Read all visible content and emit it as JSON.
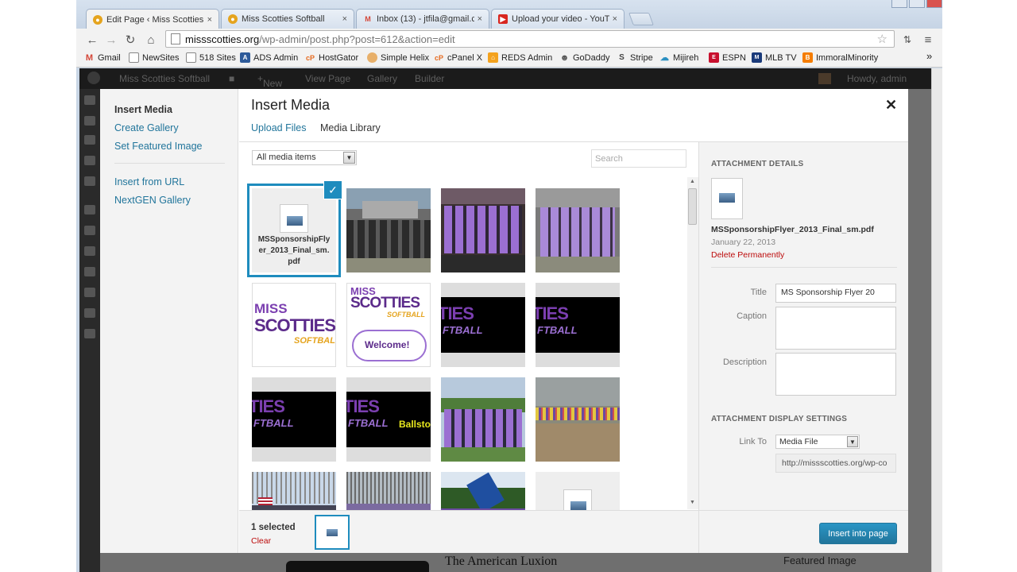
{
  "browser": {
    "tabs": [
      {
        "title": "Edit Page ‹ Miss Scotties S",
        "active": true
      },
      {
        "title": "Miss Scotties Softball",
        "active": false
      },
      {
        "title": "Inbox (13) - jtfila@gmail.c",
        "active": false
      },
      {
        "title": "Upload your video - YouT",
        "active": false
      }
    ],
    "url_domain": "missscotties.org",
    "url_path": "/wp-admin/post.php?post=612&action=edit",
    "bookmarks": [
      "Gmail",
      "NewSites",
      "518 Sites",
      "ADS Admin",
      "HostGator",
      "Simple Helix",
      "cPanel X",
      "REDS Admin",
      "GoDaddy",
      "Stripe",
      "Mijireh",
      "ESPN",
      "MLB TV",
      "ImmoralMinority"
    ]
  },
  "wp_admin_bar": {
    "site": "Miss Scotties Softball",
    "new": "New",
    "view_page": "View Page",
    "gallery": "Gallery",
    "builder": "Builder",
    "howdy": "Howdy, admin"
  },
  "wp_bottom": {
    "featured_image": "Featured Image",
    "page_text": "The American Luxion"
  },
  "media_menu": {
    "items": [
      "Insert Media",
      "Create Gallery",
      "Set Featured Image",
      "Insert from URL",
      "NextGEN Gallery"
    ]
  },
  "frame": {
    "title": "Insert Media",
    "tab_upload": "Upload Files",
    "tab_library": "Media Library",
    "filter": "All media items",
    "search_placeholder": "Search"
  },
  "attachments": [
    {
      "type": "pdf",
      "filename": "MSSponsorshipFlyer_2013_Final_sm.pdf",
      "selected": true
    },
    {
      "type": "photo",
      "desc": "team-photo"
    },
    {
      "type": "photo",
      "desc": "team-photo"
    },
    {
      "type": "photo",
      "desc": "team-photo"
    },
    {
      "type": "logo",
      "text": "MISS SCOTTIES SOFTBALL"
    },
    {
      "type": "logo",
      "text": "Welcome!"
    },
    {
      "type": "banner"
    },
    {
      "type": "banner"
    },
    {
      "type": "banner"
    },
    {
      "type": "banner",
      "text": "Ballsto"
    },
    {
      "type": "photo",
      "desc": "team-photo"
    },
    {
      "type": "photo",
      "desc": "field-photo"
    },
    {
      "type": "photo",
      "desc": "parade-photo"
    },
    {
      "type": "photo",
      "desc": "parade-photo"
    },
    {
      "type": "photo",
      "desc": "parade-photo"
    },
    {
      "type": "pdf"
    }
  ],
  "details": {
    "heading": "Attachment Details",
    "filename": "MSSponsorshipFlyer_2013_Final_sm.pdf",
    "date": "January 22, 2013",
    "delete": "Delete Permanently",
    "title_label": "Title",
    "title_value": "MS Sponsorship Flyer 20",
    "caption_label": "Caption",
    "description_label": "Description",
    "display_heading": "Attachment Display Settings",
    "link_to_label": "Link To",
    "link_to_value": "Media File",
    "link_url": "http://missscotties.org/wp-co"
  },
  "selection": {
    "count": "1 selected",
    "clear": "Clear"
  },
  "insert_button": "Insert into page",
  "colors": {
    "accent": "#21759b",
    "select_blue": "#1e8cbe",
    "danger": "#bc0b0b",
    "team_purple": "#7b3fb0"
  }
}
